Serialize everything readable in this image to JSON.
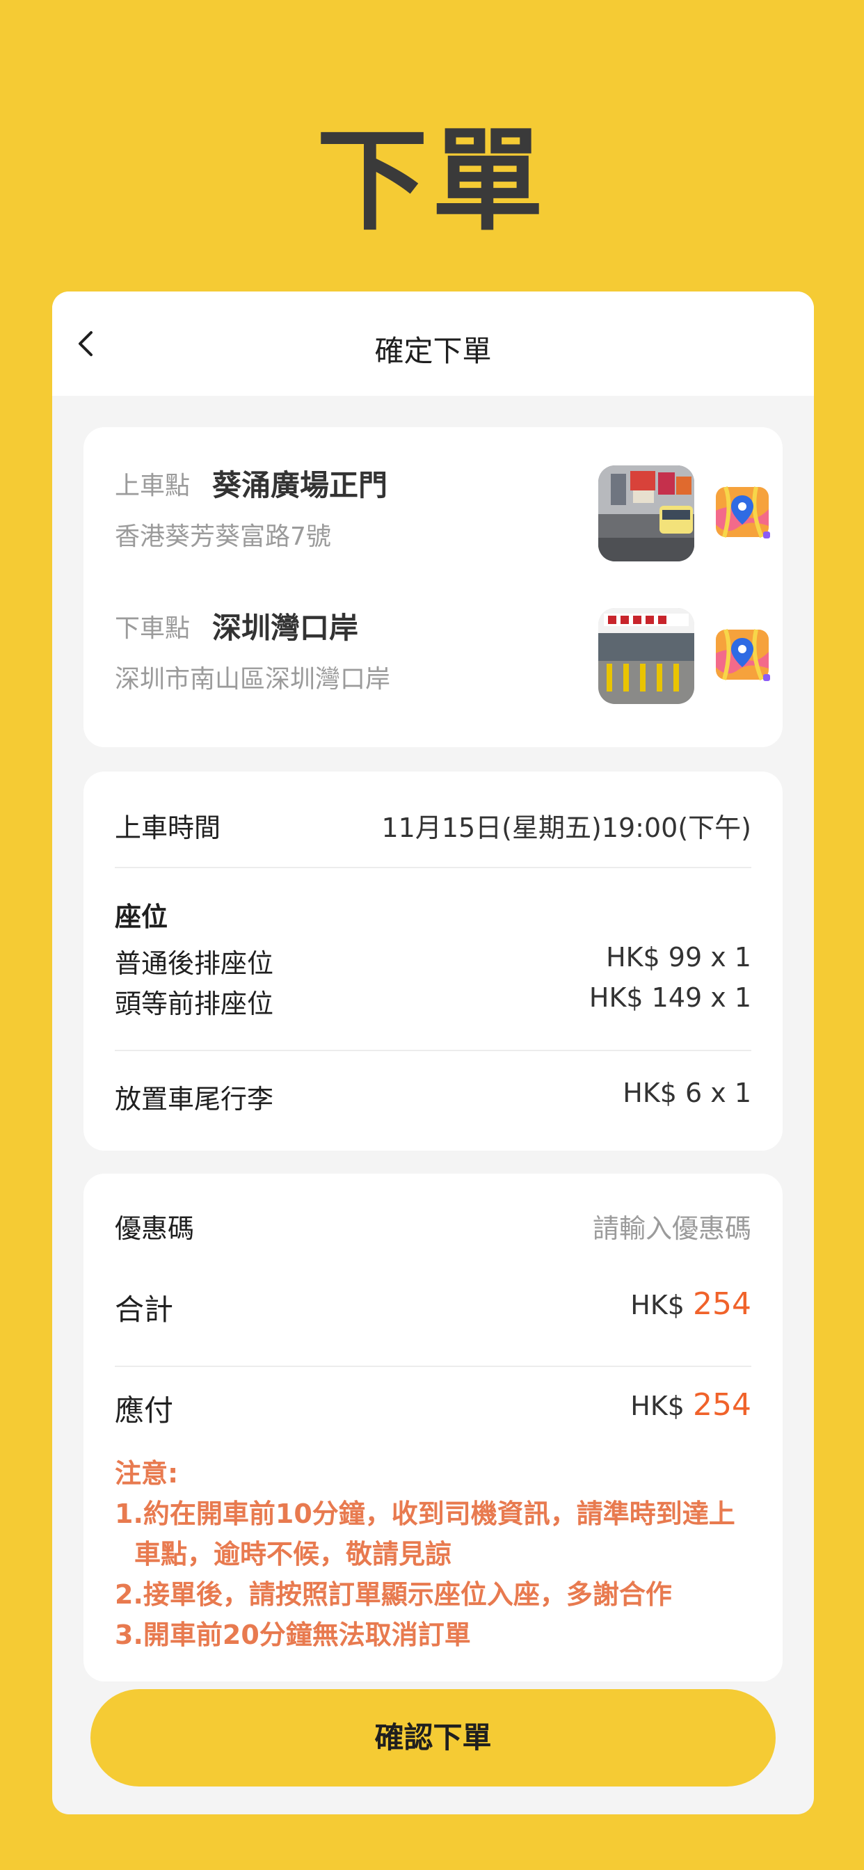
{
  "hero_title": "下單",
  "nav": {
    "title": "確定下單"
  },
  "locations": {
    "pickup": {
      "kind": "上車點",
      "name": "葵涌廣場正門",
      "address": "香港葵芳葵富路7號"
    },
    "dropoff": {
      "kind": "下車點",
      "name": "深圳灣口岸",
      "address": "深圳市南山區深圳灣口岸"
    }
  },
  "trip": {
    "time_label": "上車時間",
    "time_value": "11月15日(星期五)19:00(下午)",
    "seats_heading": "座位",
    "seats": [
      {
        "name": "普通後排座位",
        "price": "HK$ 99 x 1"
      },
      {
        "name": "頭等前排座位",
        "price": "HK$ 149 x 1"
      }
    ],
    "luggage_label": "放置車尾行李",
    "luggage_price": "HK$ 6 x 1"
  },
  "payment": {
    "coupon_label": "優惠碼",
    "coupon_placeholder": "請輸入優惠碼",
    "total_label": "合計",
    "total_currency": "HK$",
    "total_amount": "254",
    "payable_label": "應付",
    "payable_currency": "HK$",
    "payable_amount": "254"
  },
  "notice": {
    "heading": "注意:",
    "line1a": "1.約在開車前10分鐘，收到司機資訊，請準時到達上",
    "line1b": "車點，逾時不候，敬請見諒",
    "line2": "2.接單後，請按照訂單顯示座位入座，多謝合作",
    "line3": "3.開車前20分鐘無法取消訂單"
  },
  "cta_label": "確認下單",
  "colors": {
    "brand_yellow": "#F5CB34",
    "accent_orange": "#F0622A",
    "notice_orange": "#E87A4F"
  }
}
